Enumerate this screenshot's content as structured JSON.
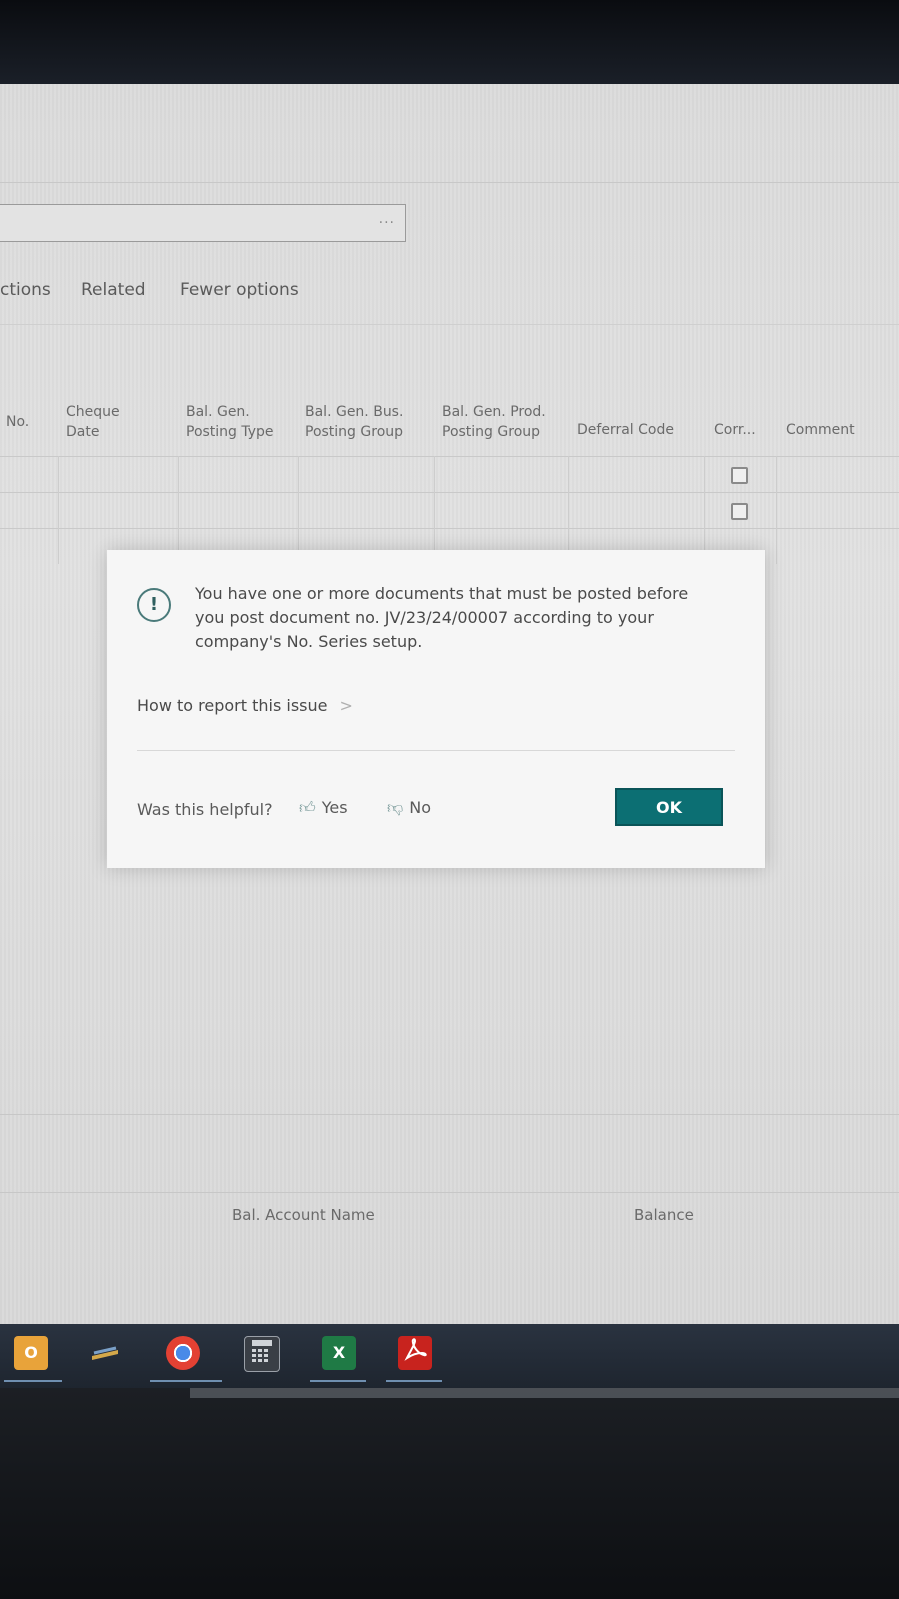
{
  "search": {
    "ellipsis": "..."
  },
  "actions": [
    {
      "label": "ctions"
    },
    {
      "label": "Related"
    },
    {
      "label": "Fewer options"
    }
  ],
  "columns": [
    {
      "label": "No."
    },
    {
      "label": "Cheque Date"
    },
    {
      "label": "Bal. Gen. Posting Type"
    },
    {
      "label": "Bal. Gen. Bus. Posting Group"
    },
    {
      "label": "Bal. Gen. Prod. Posting Group"
    },
    {
      "label": "Deferral Code"
    },
    {
      "label": "Corr..."
    },
    {
      "label": "Comment"
    }
  ],
  "dialog": {
    "icon": "!",
    "message": "You have one or more documents that must be posted before you post document no. JV/23/24/00007 according to your company's No. Series setup.",
    "report_link": "How to report this issue",
    "helpful_label": "Was this helpful?",
    "yes_label": "Yes",
    "no_label": "No",
    "ok_label": "OK"
  },
  "summary": {
    "bal_account_name_label": "Bal. Account Name",
    "balance_label": "Balance"
  },
  "colors": {
    "ok_button": "#0c6f73",
    "taskbar": "#2a3340"
  }
}
